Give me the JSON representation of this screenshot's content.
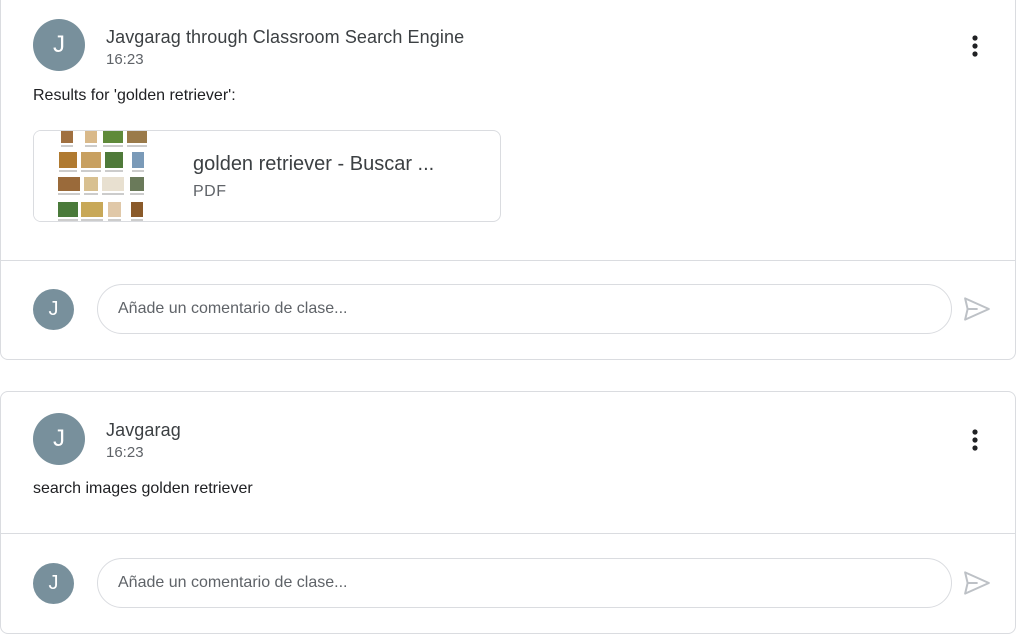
{
  "posts": [
    {
      "author": "Javgarag through Classroom Search Engine",
      "avatar_letter": "J",
      "time": "16:23",
      "text": "Results for 'golden retriever':",
      "attachment": {
        "title": "golden retriever - Buscar ...",
        "type": "PDF"
      },
      "comment_avatar_letter": "J",
      "comment_placeholder": "Añade un comentario de clase..."
    },
    {
      "author": "Javgarag",
      "avatar_letter": "J",
      "time": "16:23",
      "text": "search images golden retriever",
      "comment_avatar_letter": "J",
      "comment_placeholder": "Añade un comentario de clase..."
    }
  ],
  "icons": {
    "more": "more-vert-icon",
    "send": "send-icon"
  },
  "colors": {
    "avatar_bg": "#78909c",
    "border": "#dadce0",
    "send_disabled": "#bdc1c6"
  }
}
